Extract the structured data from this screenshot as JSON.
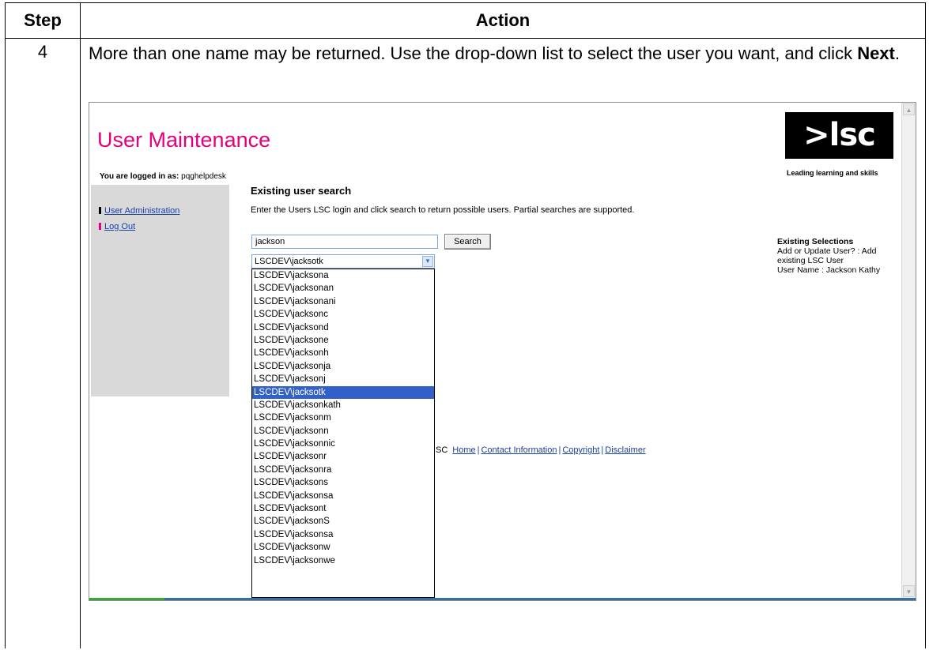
{
  "doc": {
    "headers": {
      "step": "Step",
      "action": "Action"
    },
    "step_number": "4",
    "instruction_text": "More than one name may be returned.  Use the drop-down list to select the user you want, and click ",
    "instruction_bold": "Next",
    "instruction_end": "."
  },
  "app": {
    "title": "User Maintenance",
    "logged_in_label": "You are logged in as:",
    "logged_in_user": "pqghelpdesk",
    "logo_text": ">lsc",
    "tagline": "Leading learning and skills",
    "colors": {
      "title": "#e4007c",
      "link": "#1a3fa6",
      "selected": "#3161c6",
      "sidebar": "#d9d9d9"
    }
  },
  "sidebar": {
    "items": [
      {
        "label": "User Administration",
        "bullet_color": "#000000"
      },
      {
        "label": "Log Out",
        "bullet_color": "#e4007c"
      }
    ]
  },
  "search": {
    "section_title": "Existing user search",
    "instructions": "Enter the Users LSC login and click search to return possible users. Partial searches are supported.",
    "input_value": "jackson",
    "button_label": "Search",
    "selected_value": "LSCDEV\\jacksotk"
  },
  "dropdown": {
    "options": [
      "LSCDEV\\jacksona",
      "LSCDEV\\jacksonan",
      "LSCDEV\\jacksonani",
      "LSCDEV\\jacksonc",
      "LSCDEV\\jacksond",
      "LSCDEV\\jacksone",
      "LSCDEV\\jacksonh",
      "LSCDEV\\jacksonja",
      "LSCDEV\\jacksonj",
      "LSCDEV\\jacksotk",
      "LSCDEV\\jacksonkath",
      "LSCDEV\\jacksonm",
      "LSCDEV\\jacksonn",
      "LSCDEV\\jacksonnic",
      "LSCDEV\\jacksonr",
      "LSCDEV\\jacksonra",
      "LSCDEV\\jacksons",
      "LSCDEV\\jacksonsa",
      "LSCDEV\\jacksont",
      "LSCDEV\\jacksonS",
      "LSCDEV\\jacksonsa",
      "LSCDEV\\jacksonw",
      "LSCDEV\\jacksonwe"
    ],
    "selected_index": 9
  },
  "footer": {
    "prefix": "SC",
    "links": [
      "Home",
      "Contact Information",
      "Copyright",
      "Disclaimer"
    ],
    "separator": "|"
  },
  "existing_selections": {
    "title": "Existing Selections",
    "line1": "Add or Update User? : Add existing LSC User",
    "line2": "User Name : Jackson Kathy"
  }
}
